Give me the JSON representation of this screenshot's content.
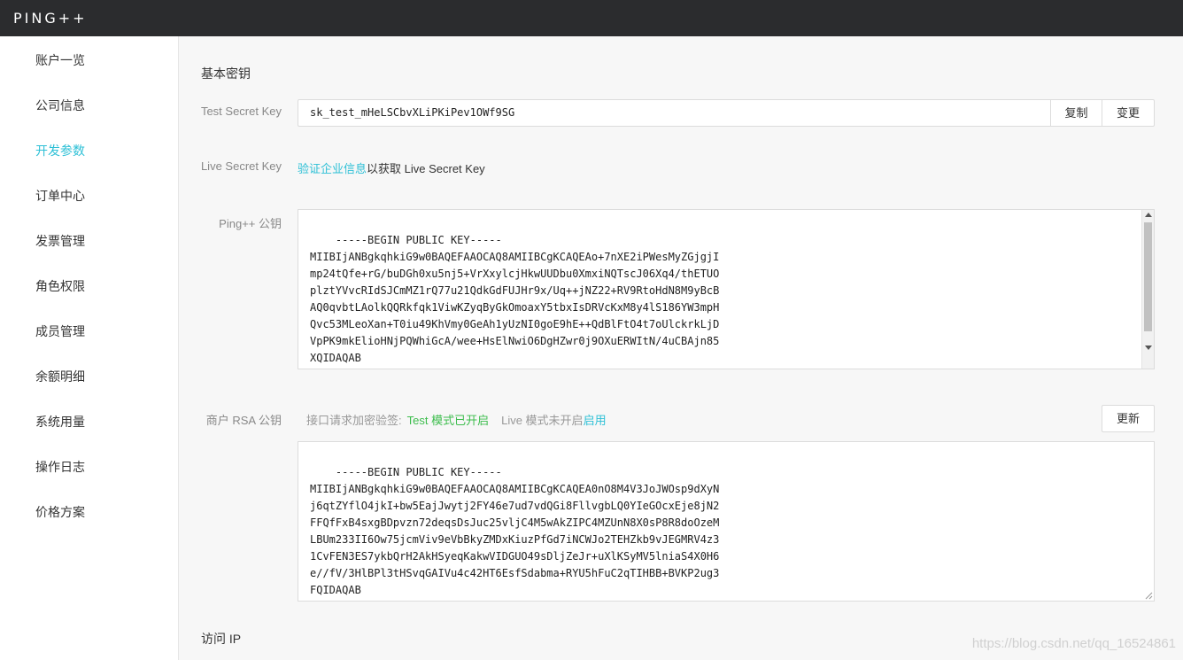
{
  "header": {
    "logo": "PING++"
  },
  "sidebar": {
    "items": [
      {
        "label": "账户一览"
      },
      {
        "label": "公司信息"
      },
      {
        "label": "开发参数"
      },
      {
        "label": "订单中心"
      },
      {
        "label": "发票管理"
      },
      {
        "label": "角色权限"
      },
      {
        "label": "成员管理"
      },
      {
        "label": "余额明细"
      },
      {
        "label": "系统用量"
      },
      {
        "label": "操作日志"
      },
      {
        "label": "价格方案"
      }
    ]
  },
  "main": {
    "basic_keys_title": "基本密钥",
    "test_secret": {
      "label": "Test Secret Key",
      "value": "sk_test_mHeLSCbvXLiPKiPev1OWf9SG",
      "copy_label": "复制",
      "change_label": "变更"
    },
    "live_secret": {
      "label": "Live Secret Key",
      "link": "验证企业信息",
      "text": "以获取 Live Secret Key"
    },
    "ping_public_key": {
      "label": "Ping++ 公钥",
      "value": "-----BEGIN PUBLIC KEY-----\nMIIBIjANBgkqhkiG9w0BAQEFAAOCAQ8AMIIBCgKCAQEAo+7nXE2iPWesMyZGjgjI\nmp24tQfe+rG/buDGh0xu5nj5+VrXxylcjHkwUUDbu0XmxiNQTscJ06Xq4/thETUO\nplztYVvcRIdSJCmMZ1rQ77u21QdkGdFUJHr9x/Uq++jNZ22+RV9RtoHdN8M9yBcB\nAQ0qvbtLAolkQQRkfqk1ViwKZyqByGkOmoaxY5tbxIsDRVcKxM8y4lS186YW3mpH\nQvc53MLeoXan+T0iu49KhVmy0GeAh1yUzNI0goE9hE++QdBlFtO4t7oUlckrkLjD\nVpPK9mkElioHNjPQWhiGcA/wee+HsElNwiO6DgHZwr0j9OXuERWItN/4uCBAjn85\nXQIDAQAB\n-----END PUBLIC KEY-----"
    },
    "merchant_rsa": {
      "label": "商户 RSA 公钥",
      "status_prefix": "接口请求加密验签:",
      "test_status": "Test 模式已开启",
      "live_status": "Live 模式未开启",
      "enable_link": "启用",
      "update_label": "更新",
      "value": "-----BEGIN PUBLIC KEY-----\nMIIBIjANBgkqhkiG9w0BAQEFAAOCAQ8AMIIBCgKCAQEA0nO8M4V3JoJWOsp9dXyN\nj6qtZYflO4jkI+bw5EajJwytj2FY46e7ud7vdQGi8FllvgbLQ0YIeGOcxEje8jN2\nFFQfFxB4sxgBDpvzn72deqsDsJuc25vljC4M5wAkZIPC4MZUnN8X0sP8R8doOzeM\nLBUm233II6Ow75jcmViv9eVbBkyZMDxKiuzPfGd7iNCWJo2TEHZkb9vJEGMRV4z3\n1CvFEN3ES7ykbQrH2AkHSyeqKakwVIDGUO49sDljZeJr+uXlKSyMV5lniaS4X0H6\ne//fV/3HlBPl3tHSvqGAIVu4c42HT6EsfSdabma+RYU5hFuC2qTIHBB+BVKP2ug3\nFQIDAQAB\n-----END PUBLIC KEY-----"
    },
    "access_ip_title": "访问 IP"
  },
  "watermark": "https://blog.csdn.net/qq_16524861"
}
